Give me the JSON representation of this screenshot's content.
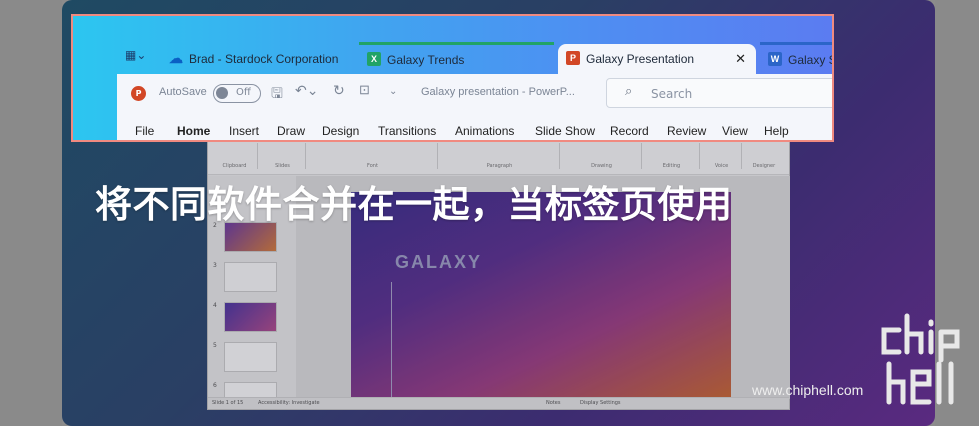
{
  "caption": "将不同软件合并在一起，当标签页使用",
  "watermark": {
    "url": "www.chiphell.com"
  },
  "tabs": [
    {
      "label": "Brad - Stardock Corporation",
      "icon": "onedrive-icon",
      "active": false
    },
    {
      "label": "Galaxy Trends",
      "icon": "excel-icon",
      "active": false
    },
    {
      "label": "Galaxy Presentation",
      "icon": "powerpoint-icon",
      "active": true
    },
    {
      "label": "Galaxy Se",
      "icon": "word-icon",
      "active": false
    }
  ],
  "toolbar": {
    "autosave_label": "AutoSave",
    "autosave_state": "Off",
    "document_title": "Galaxy presentation  -  PowerP...",
    "search_placeholder": "Search"
  },
  "menu": [
    "File",
    "Home",
    "Insert",
    "Draw",
    "Design",
    "Transitions",
    "Animations",
    "Slide Show",
    "Record",
    "Review",
    "View",
    "Help"
  ],
  "menu_selected": "Home",
  "background_window": {
    "slide_title": "GALAXY",
    "slide_numbers": [
      "2",
      "3",
      "4",
      "5",
      "6"
    ],
    "status_left": "Slide 1 of 15",
    "status_accessibility": "Accessibility: Investigate",
    "status_notes": "Notes",
    "status_display": "Display Settings"
  },
  "colors": {
    "accent_border": "#f08a80",
    "excel": "#21a366",
    "word": "#2b65c8",
    "powerpoint": "#d24726"
  }
}
